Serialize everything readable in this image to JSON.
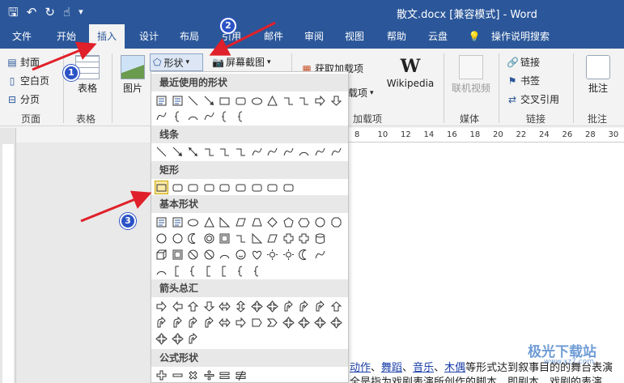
{
  "window": {
    "title": "散文.docx [兼容模式] - Word"
  },
  "qat": {
    "save": "🖫",
    "undo": "↶",
    "redo": "↻",
    "touch": "☝",
    "customize": "▾"
  },
  "tabs": [
    "文件",
    "开始",
    "插入",
    "设计",
    "布局",
    "引用",
    "邮件",
    "审阅",
    "视图",
    "帮助",
    "云盘",
    "操作说明搜索"
  ],
  "active_tab": "插入",
  "ribbon": {
    "pages_group": {
      "cover": "封面",
      "blank": "空白页",
      "break": "分页",
      "label": "页面"
    },
    "table_group": {
      "table": "表格",
      "label": "表格"
    },
    "illus_group": {
      "picture": "图片",
      "shapes": "形状",
      "screenshot": "屏幕截图"
    },
    "addins_group": {
      "get_addins": "获取加载项",
      "my_addins": "载项",
      "wikipedia": "Wikipedia",
      "label": "加载项"
    },
    "media_group": {
      "online_video": "联机视频",
      "label": "媒体"
    },
    "links_group": {
      "link": "链接",
      "bookmark": "书签",
      "crossref": "交叉引用",
      "label": "链接"
    },
    "comments_group": {
      "comment": "批注",
      "label": "批注"
    }
  },
  "ruler": {
    "ticks": [
      "8",
      "10",
      "12",
      "14",
      "16",
      "18",
      "20",
      "22",
      "24",
      "26",
      "28",
      "30"
    ]
  },
  "dropdown": {
    "sections": [
      "最近使用的形状",
      "线条",
      "矩形",
      "基本形状",
      "箭头总汇",
      "公式形状"
    ],
    "highlighted_shape": "rectangle"
  },
  "document": {
    "line1_links": [
      "动作",
      "舞蹈",
      "音乐",
      "木偶"
    ],
    "line1_sep": "、",
    "line1_tail": "等形式达到叙事目的的舞台表演",
    "line2": "全是指为戏剧表演所创作的脚本，即剧本。戏剧的表演"
  },
  "annotations": {
    "badge1": "1",
    "badge2": "2",
    "badge3": "3"
  },
  "watermark": {
    "text": "极光下载站",
    "url": "www.xz7.com"
  },
  "colors": {
    "brand": "#2b579a",
    "arrow": "#e0202a",
    "badge": "#2b53c6"
  }
}
